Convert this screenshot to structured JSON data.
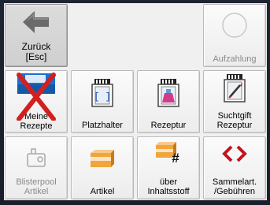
{
  "buttons": {
    "back": {
      "label": "Zurück\n[Esc]",
      "icon": "arrow-left-icon"
    },
    "list": {
      "label": "Aufzahlung",
      "icon": "circle-icon",
      "disabled": true
    },
    "recipes": {
      "label": "Meine\nRezepte",
      "icon": "recipes-logo-crossed-icon"
    },
    "placeholder": {
      "label": "Platzhalter",
      "icon": "placeholder-jar-icon"
    },
    "compounding": {
      "label": "Rezeptur",
      "icon": "compounding-jar-icon"
    },
    "narcotic": {
      "label": "Suchtgift\nRezeptur",
      "icon": "narcotic-jar-icon"
    },
    "blisterpool": {
      "label": "Blisterpool\nArtikel",
      "icon": "blister-icon",
      "disabled": true
    },
    "article": {
      "label": "Artikel",
      "icon": "article-box-icon"
    },
    "ingredient": {
      "label": "über\nInhaltsstoff",
      "icon": "box-hash-icon"
    },
    "collective": {
      "label": "Sammelart.\n/Gebühren",
      "icon": "code-brackets-icon"
    }
  },
  "colors": {
    "background": "#1c2030",
    "tile": "#f0f0f0",
    "cross": "#d22020",
    "bracket": "#c0161e"
  }
}
